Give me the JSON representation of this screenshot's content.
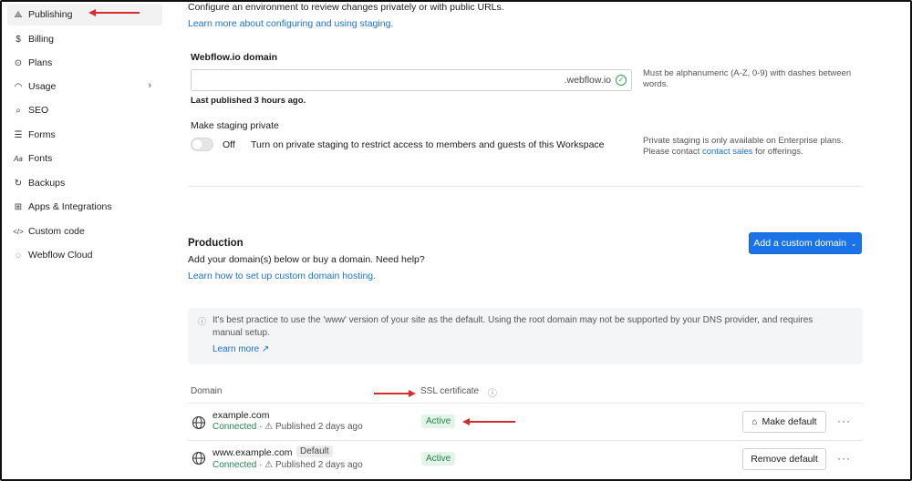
{
  "sidebar": {
    "items": [
      {
        "label": "Publishing",
        "icon": "rocket-icon",
        "glyph": "⟁",
        "active": true
      },
      {
        "label": "Billing",
        "icon": "dollar-icon",
        "glyph": "$"
      },
      {
        "label": "Plans",
        "icon": "plans-icon",
        "glyph": "⊙"
      },
      {
        "label": "Usage",
        "icon": "gauge-icon",
        "glyph": "◠",
        "has_chevron": true
      },
      {
        "label": "SEO",
        "icon": "search-icon",
        "glyph": "⌕"
      },
      {
        "label": "Forms",
        "icon": "forms-icon",
        "glyph": "☰"
      },
      {
        "label": "Fonts",
        "icon": "fonts-icon",
        "glyph": "Aa"
      },
      {
        "label": "Backups",
        "icon": "backups-icon",
        "glyph": "↻"
      },
      {
        "label": "Apps & Integrations",
        "icon": "apps-icon",
        "glyph": "⊞"
      },
      {
        "label": "Custom code",
        "icon": "code-icon",
        "glyph": "</>"
      },
      {
        "label": "Webflow Cloud",
        "icon": "cloud-icon",
        "glyph": "◌"
      }
    ],
    "chevron": "›"
  },
  "staging": {
    "description": "Configure an environment to review changes privately or with public URLs.",
    "learn_link": "Learn more about configuring and using staging.",
    "domain_label": "Webflow.io domain",
    "domain_value": "",
    "domain_suffix": ".webflow.io",
    "domain_hint": "Must be alphanumeric (A-Z, 0-9) with dashes between words.",
    "last_published": "Last published 3 hours ago.",
    "private_label": "Make staging private",
    "toggle_state": "Off",
    "toggle_description": "Turn on private staging to restrict access to members and guests of this Workspace",
    "enterprise_note_line1": "Private staging is only available on Enterprise plans.",
    "enterprise_note_prefix": "Please contact ",
    "enterprise_note_link": "contact sales",
    "enterprise_note_suffix": " for offerings."
  },
  "production": {
    "title": "Production",
    "subtitle": "Add your domain(s) below or buy a domain. Need help?",
    "hosting_link": "Learn how to set up custom domain hosting.",
    "add_domain_button": "Add a custom domain",
    "notice_text_line1": "It's best practice to use the 'www' version of your site as the default. Using the root domain may not be supported by your DNS provider, and requires",
    "notice_text_line2": "manual setup.",
    "notice_link": "Learn more ↗",
    "table": {
      "col_domain": "Domain",
      "col_ssl": "SSL certificate",
      "rows": [
        {
          "domain": "example.com",
          "status": "Connected",
          "published": "Published 2 days ago",
          "ssl": "Active",
          "action": "Make default",
          "is_default": false
        },
        {
          "domain": "www.example.com",
          "status": "Connected",
          "published": "Published 2 days ago",
          "ssl": "Active",
          "action": "Remove default",
          "is_default": true,
          "default_tag": "Default"
        }
      ]
    }
  },
  "colors": {
    "accent": "#1a73e8",
    "link": "#1a6fd6",
    "success": "#23854a",
    "annotation_arrow": "#d32f2f"
  }
}
